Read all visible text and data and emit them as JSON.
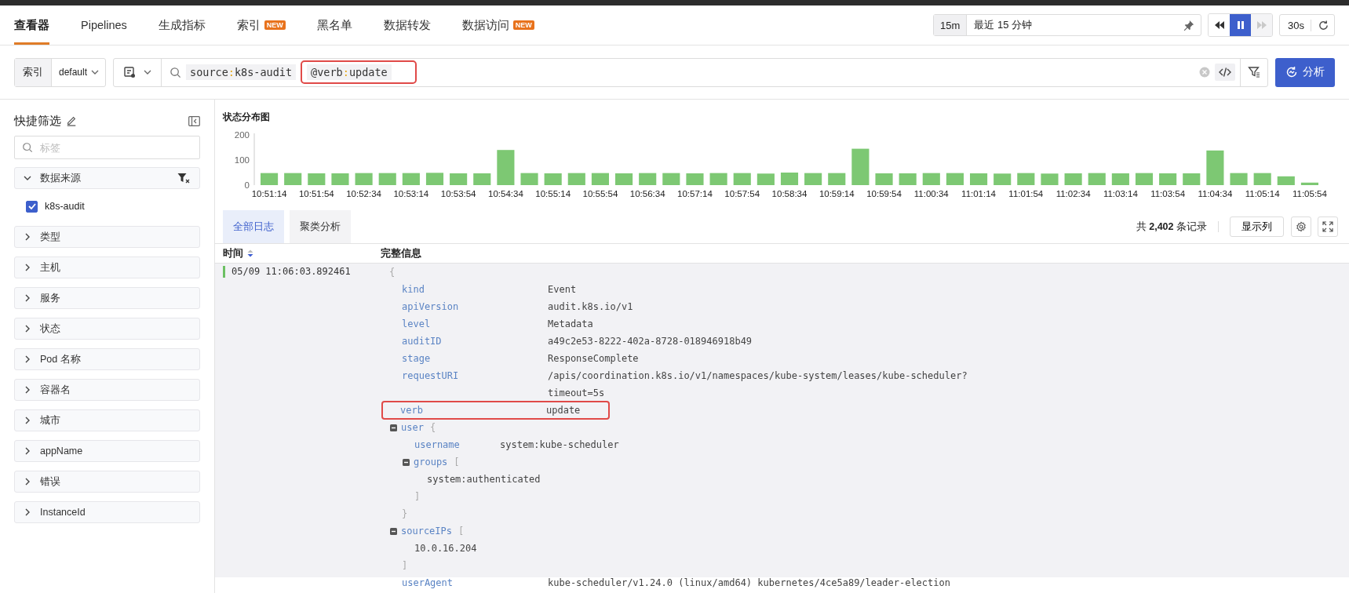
{
  "nav": {
    "tabs": [
      {
        "label": "查看器",
        "selected": true
      },
      {
        "label": "Pipelines",
        "selected": false
      },
      {
        "label": "生成指标",
        "selected": false
      },
      {
        "label": "索引",
        "badge": "NEW",
        "selected": false
      },
      {
        "label": "黑名单",
        "selected": false
      },
      {
        "label": "数据转发",
        "selected": false
      },
      {
        "label": "数据访问",
        "badge": "NEW",
        "selected": false
      }
    ],
    "time_picker": {
      "preset": "15m",
      "label": "最近 15 分钟"
    },
    "playback": [
      {
        "kind": "rewind",
        "selected": false,
        "disabled": false
      },
      {
        "kind": "pause",
        "selected": true,
        "disabled": false
      },
      {
        "kind": "forward",
        "selected": false,
        "disabled": true
      }
    ],
    "refresh": {
      "interval": "30s"
    }
  },
  "query_bar": {
    "index_label": "索引",
    "index_value": "default",
    "tokens": [
      {
        "key": "source",
        "separator": ":",
        "value": "k8s-audit",
        "highlighted": false
      },
      {
        "key": "@verb",
        "separator": ":",
        "value": "update",
        "highlighted": true
      }
    ],
    "analyze_button": "分析"
  },
  "sidebar": {
    "title": "快捷筛选",
    "search": {
      "placeholder": "标签"
    },
    "facets": [
      {
        "label": "数据来源",
        "expanded": true,
        "options": [
          {
            "label": "k8s-audit",
            "checked": true
          }
        ]
      },
      {
        "label": "类型",
        "expanded": false
      },
      {
        "label": "主机",
        "expanded": false
      },
      {
        "label": "服务",
        "expanded": false
      },
      {
        "label": "状态",
        "expanded": false
      },
      {
        "label": "Pod 名称",
        "expanded": false
      },
      {
        "label": "容器名",
        "expanded": false
      },
      {
        "label": "城市",
        "expanded": false
      },
      {
        "label": "appName",
        "expanded": false
      },
      {
        "label": "错误",
        "expanded": false
      },
      {
        "label": "InstanceId",
        "expanded": false
      }
    ]
  },
  "chart": {
    "title": "状态分布图",
    "chart_data": {
      "type": "bar",
      "categories": [
        "10:51:14",
        null,
        "10:51:54",
        null,
        "10:52:34",
        null,
        "10:53:14",
        null,
        "10:53:54",
        null,
        "10:54:34",
        null,
        "10:55:14",
        null,
        "10:55:54",
        null,
        "10:56:34",
        null,
        "10:57:14",
        null,
        "10:57:54",
        null,
        "10:58:34",
        null,
        "10:59:14",
        null,
        "10:59:54",
        null,
        "11:00:34",
        null,
        "11:01:14",
        null,
        "11:01:54",
        null,
        "11:02:34",
        null,
        "11:03:14",
        null,
        "11:03:54",
        null,
        "11:04:34",
        null,
        "11:05:14",
        null,
        "11:05:54"
      ],
      "values": [
        48,
        48,
        47,
        47,
        48,
        48,
        48,
        49,
        47,
        47,
        140,
        48,
        47,
        48,
        48,
        47,
        48,
        48,
        47,
        48,
        48,
        46,
        50,
        48,
        48,
        145,
        47,
        47,
        48,
        48,
        47,
        46,
        48,
        46,
        47,
        48,
        47,
        48,
        47,
        47,
        138,
        48,
        48,
        35,
        10
      ],
      "ylim": [
        0,
        200
      ],
      "yticks": [
        0,
        100,
        200
      ]
    }
  },
  "log_tabs": [
    {
      "label": "全部日志",
      "selected": true
    },
    {
      "label": "聚类分析",
      "selected": false
    }
  ],
  "record_count": "共 **2,402** 条记录",
  "columns_button": "显示列",
  "table": {
    "columns": [
      "时间",
      "完整信息"
    ],
    "record": {
      "time": "05/09 11:06:03.892461",
      "open": "{",
      "fields": [
        {
          "kind": "pair",
          "key": "kind",
          "value": "Event",
          "highlighted": false
        },
        {
          "kind": "pair",
          "key": "apiVersion",
          "value": "audit.k8s.io/v1",
          "highlighted": false
        },
        {
          "kind": "pair",
          "key": "level",
          "value": "Metadata",
          "highlighted": false
        },
        {
          "kind": "pair",
          "key": "auditID",
          "value": "a49c2e53-8222-402a-8728-018946918b49",
          "highlighted": false
        },
        {
          "kind": "pair",
          "key": "stage",
          "value": "ResponseComplete",
          "highlighted": false
        },
        {
          "kind": "pair",
          "key": "requestURI",
          "value_lines": [
            "/apis/coordination.k8s.io/v1/namespaces/kube-system/leases/kube-scheduler?",
            "timeout=5s"
          ],
          "highlighted": false
        },
        {
          "kind": "pair",
          "key": "verb",
          "value": "update",
          "highlighted": true
        },
        {
          "kind": "object",
          "key": "user",
          "open": "{",
          "close": "}",
          "expanded": true,
          "children": [
            {
              "kind": "pair",
              "key": "username",
              "value": "system:kube-scheduler",
              "highlighted": false
            },
            {
              "kind": "array",
              "key": "groups",
              "open": "[",
              "close": "]",
              "expanded": true,
              "children": [
                {
                  "kind": "item",
                  "value": "system:authenticated"
                }
              ]
            }
          ]
        },
        {
          "kind": "array",
          "key": "sourceIPs",
          "open": "[",
          "close": "]",
          "expanded": true,
          "children": [
            {
              "kind": "item",
              "value": "10.0.16.204"
            }
          ]
        },
        {
          "kind": "pair",
          "key": "userAgent",
          "value": "kube-scheduler/v1.24.0 (linux/amd64) kubernetes/4ce5a89/leader-election",
          "highlighted": false
        }
      ]
    }
  }
}
